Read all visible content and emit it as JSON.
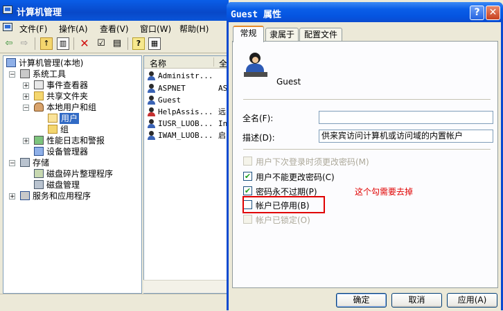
{
  "mmc": {
    "title": "计算机管理",
    "menu": [
      "文件(F)",
      "操作(A)",
      "查看(V)",
      "窗口(W)",
      "帮助(H)"
    ],
    "toolbar_icons": [
      "back-arrow-icon",
      "forward-arrow-icon",
      "up-folder-icon",
      "show-hide-tree-icon",
      "delete-icon",
      "properties-icon",
      "export-list-icon",
      "help-icon",
      "console-icon"
    ],
    "tree": [
      {
        "label": "计算机管理(本地)",
        "icon": "computer-icon",
        "expander": ""
      },
      {
        "label": "系统工具",
        "icon": "tools-icon",
        "expander": "−"
      },
      {
        "label": "事件查看器",
        "icon": "event-viewer-icon",
        "expander": "+"
      },
      {
        "label": "共享文件夹",
        "icon": "shared-folder-icon",
        "expander": "+"
      },
      {
        "label": "本地用户和组",
        "icon": "users-icon",
        "expander": "−"
      },
      {
        "label": "用户",
        "icon": "folder-open-icon",
        "expander": ""
      },
      {
        "label": "组",
        "icon": "folder-icon",
        "expander": ""
      },
      {
        "label": "性能日志和警报",
        "icon": "performance-icon",
        "expander": "+"
      },
      {
        "label": "设备管理器",
        "icon": "device-manager-icon",
        "expander": ""
      },
      {
        "label": "存储",
        "icon": "storage-icon",
        "expander": "−"
      },
      {
        "label": "磁盘碎片整理程序",
        "icon": "defrag-icon",
        "expander": ""
      },
      {
        "label": "磁盘管理",
        "icon": "disk-icon",
        "expander": ""
      },
      {
        "label": "服务和应用程序",
        "icon": "services-icon",
        "expander": "+"
      }
    ],
    "list_headers": [
      "名称",
      "全"
    ],
    "list_rows": [
      {
        "name": "Administr...",
        "col2": "",
        "disabled": false
      },
      {
        "name": "ASPNET",
        "col2": "AS",
        "disabled": false
      },
      {
        "name": "Guest",
        "col2": "",
        "disabled": false
      },
      {
        "name": "HelpAssis...",
        "col2": "远",
        "disabled": true
      },
      {
        "name": "IUSR_LUOB...",
        "col2": "In",
        "disabled": false
      },
      {
        "name": "IWAM_LUOB...",
        "col2": "启",
        "disabled": false
      }
    ]
  },
  "dialog": {
    "title": "Guest 属性",
    "tabs": [
      "常规",
      "隶属于",
      "配置文件"
    ],
    "user_name": "Guest",
    "full_name_label": "全名(F):",
    "full_name_value": "",
    "description_label": "描述(D):",
    "description_value": "供来宾访问计算机或访问域的内置帐户",
    "checkboxes": [
      {
        "label": "用户下次登录时须更改密码(M)",
        "checked": false,
        "enabled": false
      },
      {
        "label": "用户不能更改密码(C)",
        "checked": true,
        "enabled": true
      },
      {
        "label": "密码永不过期(P)",
        "checked": true,
        "enabled": true
      },
      {
        "label": "帐户已停用(B)",
        "checked": false,
        "enabled": true
      },
      {
        "label": "帐户已锁定(O)",
        "checked": false,
        "enabled": false
      }
    ],
    "annotation": "这个勾需要去掉",
    "buttons": {
      "ok": "确定",
      "cancel": "取消",
      "apply": "应用(A)"
    },
    "colors": {
      "annotation_red": "#e00000",
      "title_blue": "#0a5ee8"
    }
  }
}
